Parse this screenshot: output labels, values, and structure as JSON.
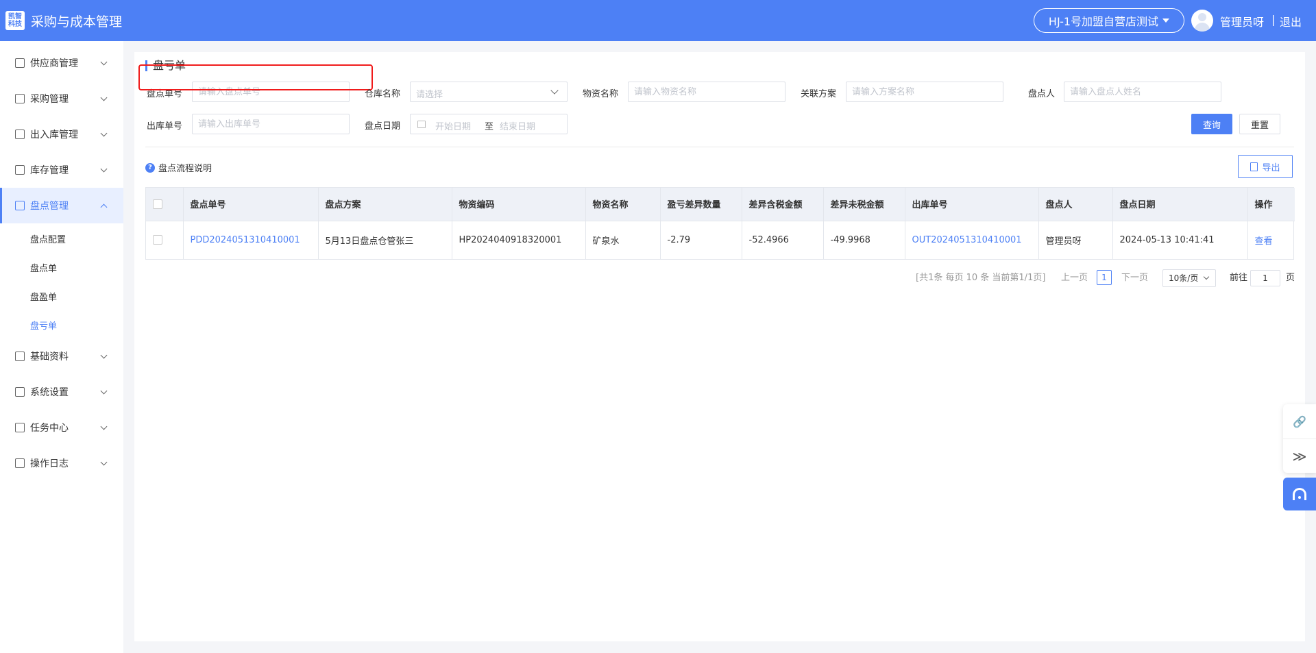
{
  "header": {
    "logo_line1": "凯智",
    "logo_line2": "科技",
    "app_title": "采购与成本管理",
    "store_name": "HJ-1号加盟自营店测试",
    "username": "管理员呀",
    "separator": "|",
    "logout": "退出"
  },
  "sidebar": {
    "items": [
      {
        "label": "供应商管理"
      },
      {
        "label": "采购管理"
      },
      {
        "label": "出入库管理"
      },
      {
        "label": "库存管理"
      },
      {
        "label": "盘点管理"
      },
      {
        "label": "基础资料"
      },
      {
        "label": "系统设置"
      },
      {
        "label": "任务中心"
      },
      {
        "label": "操作日志"
      }
    ],
    "sub_items": [
      {
        "label": "盘点配置"
      },
      {
        "label": "盘点单"
      },
      {
        "label": "盘盈单"
      },
      {
        "label": "盘亏单"
      }
    ]
  },
  "page": {
    "title": "盘亏单"
  },
  "filters": {
    "count_no_label": "盘点单号",
    "count_no_placeholder": "请输入盘点单号",
    "warehouse_label": "仓库名称",
    "warehouse_placeholder": "请选择",
    "material_label": "物资名称",
    "material_placeholder": "请输入物资名称",
    "plan_label": "关联方案",
    "plan_placeholder": "请输入方案名称",
    "counter_label": "盘点人",
    "counter_placeholder": "请输入盘点人姓名",
    "outbound_label": "出库单号",
    "outbound_placeholder": "请输入出库单号",
    "date_label": "盘点日期",
    "date_start": "开始日期",
    "date_to": "至",
    "date_end": "结束日期",
    "query_button": "查询",
    "reset_button": "重置"
  },
  "toolbar": {
    "help_icon": "?",
    "help_text": "盘点流程说明",
    "export_button": "导出"
  },
  "table": {
    "headers": [
      "盘点单号",
      "盘点方案",
      "物资编码",
      "物资名称",
      "盈亏差异数量",
      "差异含税金额",
      "差异未税金额",
      "出库单号",
      "盘点人",
      "盘点日期",
      "操作"
    ],
    "rows": [
      {
        "count_no": "PDD2024051310410001",
        "plan": "5月13日盘点仓管张三",
        "material_code": "HP2024040918320001",
        "material_name": "矿泉水",
        "diff_qty": "-2.79",
        "diff_tax_amount": "-52.4966",
        "diff_untaxed_amount": "-49.9968",
        "outbound_no": "OUT2024051310410001",
        "counter": "管理员呀",
        "count_date": "2024-05-13 10:41:41",
        "action": "查看"
      }
    ]
  },
  "pagination": {
    "summary": "[共1条 每页 10 条 当前第1/1页]",
    "prev": "上一页",
    "current_page": "1",
    "next": "下一页",
    "page_size": "10条/页",
    "goto_label": "前往",
    "goto_value": "1",
    "page_suffix": "页"
  },
  "float_toolbar": {
    "link_icon": "🔗",
    "collapse_icon": "≫"
  },
  "colors": {
    "primary": "#4d80f5",
    "highlight_box": "#f01b1b"
  }
}
